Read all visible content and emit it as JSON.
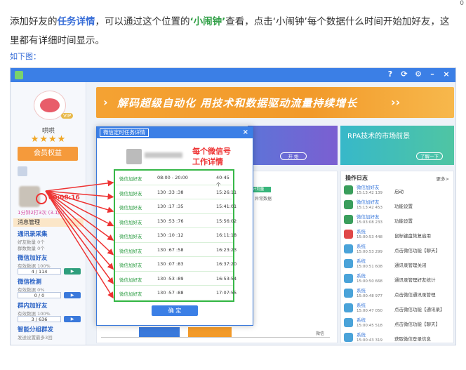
{
  "text": {
    "p1_a": "添加好友的",
    "p1_b": "任务详情",
    "p1_c": "，可以通过这个位置的",
    "p1_d": "‘小闹钟’",
    "p1_e": "查看，点击‘小闹钟’每个数据什么时间开始加好友，这里都有详细时间显示。",
    "sub": "如下图：",
    "corner": "0"
  },
  "app": {
    "banner": "解码超级自动化 用技术和数据驱动流量持续增长",
    "card_left_btn": "开 始",
    "card_right_title": "RPA技术的市场前景",
    "card_right_btn": "了解一下",
    "legend1": "计划量",
    "legend2": "异常数据",
    "x_label": "微信"
  },
  "sidebar": {
    "name": "哄哄",
    "stars": "★★★★",
    "member": "会员权益",
    "timer": "00:08:16",
    "pink": "1分钟2打3次 (3.1/5)",
    "sec1": "消息管理",
    "items": [
      {
        "title": "通讯录采集",
        "sub1": "好友数量 0个",
        "sub2": "群数数量 0个"
      },
      {
        "title": "微信加好友",
        "sub1": "有效数据 100%",
        "bar": "4 / 114"
      },
      {
        "title": "微信检测",
        "sub1": "有效数据 0%",
        "bar": "0 / 0"
      },
      {
        "title": "群内加好友",
        "sub1": "有效数据 100%",
        "bar": "3 / 636"
      },
      {
        "title": "智能分组群发",
        "sub1": "发送设置最多3回"
      }
    ]
  },
  "dialog": {
    "title": "微信定时任务详情",
    "note_line1": "每个微信号",
    "note_line2": "工作详情",
    "ok": "确 定",
    "rows": [
      [
        "微信加好友",
        "08:00 - 20:00",
        "",
        "40-45个"
      ],
      [
        "微信加好友",
        "130 :33 :38",
        "",
        "15:26:11"
      ],
      [
        "微信加好友",
        "130 :17 :35",
        "",
        "15:41:01"
      ],
      [
        "微信加好友",
        "130 :53 :76",
        "",
        "15:56:02"
      ],
      [
        "微信加好友",
        "130 :10 :12",
        "",
        "16:11:18"
      ],
      [
        "微信加好友",
        "130 :67 :58",
        "",
        "16:23:23"
      ],
      [
        "微信加好友",
        "130 :07 :83",
        "",
        "16:37:20"
      ],
      [
        "微信加好友",
        "130 :53 :89",
        "",
        "16:53:54"
      ],
      [
        "微信加好友",
        "130 :57 :88",
        "",
        "17:07:55"
      ]
    ]
  },
  "log": {
    "title": "操作日志",
    "more": "更多>",
    "rows": [
      {
        "who": "微信加好友",
        "time": "15:13:42 139",
        "act": "启动",
        "color": "#3a9e5c"
      },
      {
        "who": "微信加好友",
        "time": "15:13:42 453",
        "act": "功能设置",
        "color": "#3a9e5c"
      },
      {
        "who": "微信加好友",
        "time": "15:03:08 233",
        "act": "功能设置",
        "color": "#3a9e5c"
      },
      {
        "who": "系统",
        "time": "15:00:53 448",
        "act": "鼠标键盘恢复启用",
        "color": "#e04848"
      },
      {
        "who": "系统",
        "time": "15:00:53 299",
        "act": "点击微信功能【聊天】",
        "color": "#4aa3d9"
      },
      {
        "who": "系统",
        "time": "15:00:51 608",
        "act": "通讯录管理关闭",
        "color": "#4aa3d9"
      },
      {
        "who": "系统",
        "time": "15:00:50 668",
        "act": "通讯录管理好友统计",
        "color": "#4aa3d9"
      },
      {
        "who": "系统",
        "time": "15:00:48 977",
        "act": "点击微信通讯录管理",
        "color": "#4aa3d9"
      },
      {
        "who": "系统",
        "time": "15:00:47 050",
        "act": "点击微信功能【通讯录】",
        "color": "#4aa3d9"
      },
      {
        "who": "系统",
        "time": "15:00:45 518",
        "act": "点击微信功能【聊天】",
        "color": "#4aa3d9"
      },
      {
        "who": "系统",
        "time": "15:00:43 319",
        "act": "获取微信登录信息",
        "color": "#4aa3d9"
      }
    ]
  }
}
